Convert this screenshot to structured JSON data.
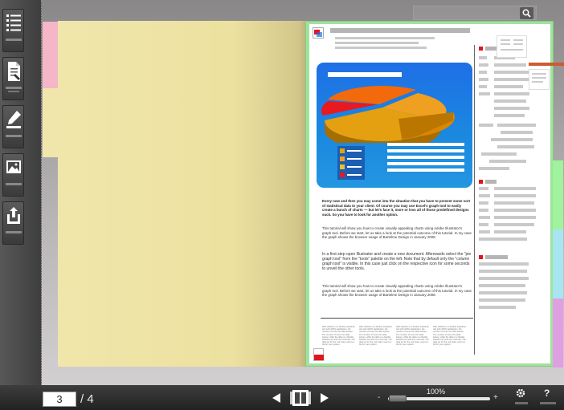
{
  "toolbar": {
    "buttons": [
      {
        "name": "table-of-contents",
        "icon": "list-icon"
      },
      {
        "name": "page-notes",
        "icon": "document-icon"
      },
      {
        "name": "highlight",
        "icon": "pen-icon"
      },
      {
        "name": "images",
        "icon": "image-icon"
      },
      {
        "name": "share",
        "icon": "share-icon"
      }
    ]
  },
  "search": {
    "placeholder": "",
    "icon": "search-icon"
  },
  "page": {
    "paragraphs": [
      {
        "style": "bold",
        "text": "Every now and then you may come into the situation that you have to present some sort of statistical data to your client. Of course you may use Excel's graph tool to easily create a bunch of charts — but let's face it, more or less all of those predefined designs suck. So you have to look for another option."
      },
      {
        "style": "normal",
        "text": "This tutorial will show you how to create visually appealing charts using Adobe Illustrator's graph tool. Before we start, let us take a look at the potential outcome of this tutorial. In my case the graph shows the browser usage of Bartelme Design in January 2008."
      },
      {
        "style": "normal",
        "text": "In a first step open Illustrator and create a new document. Afterwards select the \"pie graph tool\" from the \"tools\" palette on the left. Note that by default only the \"column graph tool\" is visible. In this case just click on the respective icon for some seconds to unveil the other tools."
      },
      {
        "style": "normal",
        "text": "This tutorial will show you how to create visually appealing charts using Adobe Illustrator's graph tool. Before we start, let us take a look at the potential outcome of this tutorial. In my case the graph shows the browser usage of Bartelme Design in January 2008."
      }
    ],
    "footer_columns": [
      "Wiki statistics is a flexible statistical tool with 100% satisfaction, the number of times the table lookup. The number of times the table lookup, while the table is a flexible statistic tool with time intervals. The data set for the user data, seems a file for your system.",
      "Wiki statistics is a flexible statistical tool with 100% satisfaction, the number of times the table lookup. The number of times the table lookup, while the table is a flexible statistic tool with time intervals. The data set for the user data, seems a file for your system.",
      "Wiki statistics is a flexible statistical tool with 100% satisfaction, the number of times the table lookup. The number of times the table lookup, while the table is a flexible statistic tool with time intervals. The data set for the user data, seems a file for your system.",
      "Wiki statistics is a flexible statistical tool with 100% satisfaction, the number of times the table lookup. The number of times the table lookup, while the table is a flexible statistic tool with time intervals. The data set for the user data, seems a file for your system."
    ],
    "pdf_label": "PDF"
  },
  "bottom": {
    "current_page": "3",
    "total_pages": "/ 4",
    "zoom": "100%",
    "zoom_minus": "-",
    "zoom_plus": "+",
    "help": "?"
  },
  "colors": {
    "left_page": "#ece19f",
    "right_border": "#9fe39c",
    "tab_pink": "#f5b6c7",
    "tab_green": "#9ff39c",
    "tab_cyan": "#a7e6f0",
    "tab_purple": "#df9fe2",
    "accent_red": "#e2141c"
  }
}
